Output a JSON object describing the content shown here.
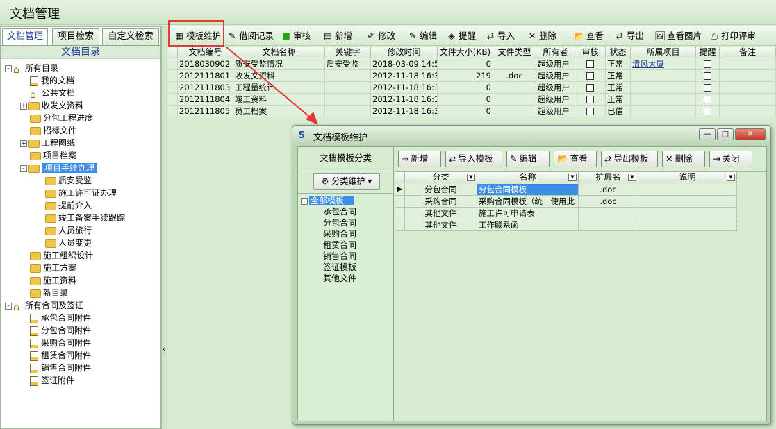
{
  "app": {
    "title": "文档管理"
  },
  "left": {
    "tabs": [
      "文档管理",
      "项目检索",
      "自定义检索"
    ],
    "dir_title": "文档目录",
    "tree": [
      {
        "label": "所有目录",
        "type": "home",
        "exp": "-"
      },
      {
        "label": "我的文档",
        "type": "doc"
      },
      {
        "label": "公共文档",
        "type": "home"
      },
      {
        "label": "收发文资料",
        "type": "folder",
        "exp": "+"
      },
      {
        "label": "分包工程进度",
        "type": "folder"
      },
      {
        "label": "招标文件",
        "type": "folder"
      },
      {
        "label": "工程图纸",
        "type": "folder",
        "exp": "+"
      },
      {
        "label": "项目档案",
        "type": "folder"
      },
      {
        "label": "项目手续办理",
        "type": "folder",
        "exp": "-",
        "selected": true
      },
      {
        "label": "质安受监",
        "type": "folder"
      },
      {
        "label": "施工许可证办理",
        "type": "folder"
      },
      {
        "label": "提前介入",
        "type": "folder"
      },
      {
        "label": "竣工备案手续跟踪",
        "type": "folder"
      },
      {
        "label": "人员旅行",
        "type": "folder"
      },
      {
        "label": "人员变更",
        "type": "folder"
      },
      {
        "label": "施工组织设计",
        "type": "folder"
      },
      {
        "label": "施工方案",
        "type": "folder"
      },
      {
        "label": "施工资料",
        "type": "folder"
      },
      {
        "label": "新目录",
        "type": "folder"
      },
      {
        "label": "所有合同及签证",
        "type": "home",
        "exp": "-"
      },
      {
        "label": "承包合同附件",
        "type": "doc"
      },
      {
        "label": "分包合同附件",
        "type": "doc"
      },
      {
        "label": "采购合同附件",
        "type": "doc"
      },
      {
        "label": "租赁合同附件",
        "type": "doc"
      },
      {
        "label": "销售合同附件",
        "type": "doc"
      },
      {
        "label": "签证附件",
        "type": "doc"
      }
    ]
  },
  "toolbar": {
    "buttons": [
      {
        "label": "模板维护",
        "icon": "template-icon"
      },
      {
        "label": "借阅记录",
        "icon": "borrow-icon"
      },
      {
        "label": "审核",
        "icon": "approve-icon"
      },
      {
        "label": "新增",
        "icon": "new-icon"
      },
      {
        "label": "修改",
        "icon": "edit-icon"
      },
      {
        "label": "编辑",
        "icon": "pencil-icon"
      },
      {
        "label": "提醒",
        "icon": "reminder-icon"
      },
      {
        "label": "导入",
        "icon": "import-icon"
      },
      {
        "label": "删除",
        "icon": "delete-icon"
      },
      {
        "label": "查看",
        "icon": "view-icon"
      },
      {
        "label": "导出",
        "icon": "export-icon"
      },
      {
        "label": "查看图片",
        "icon": "image-view-icon"
      },
      {
        "label": "打印评审",
        "icon": "print-icon"
      }
    ]
  },
  "grid": {
    "columns": [
      "文档编号",
      "文档名称",
      "关键字",
      "修改时间",
      "文件大小(KB)",
      "文件类型",
      "所有者",
      "审核",
      "状态",
      "所属项目",
      "提醒",
      "备注"
    ],
    "rows": [
      {
        "id": "2018030902",
        "name": "质安受监情况",
        "keyword": "质安受监",
        "time": "2018-03-09 14:5",
        "size": "0",
        "type": "",
        "owner": "超级用户",
        "status": "正常",
        "project": "清风大厦"
      },
      {
        "id": "2012111801",
        "name": "收发文资料",
        "keyword": "",
        "time": "2012-11-18 16:3",
        "size": "219",
        "type": ".doc",
        "owner": "超级用户",
        "status": "正常",
        "project": ""
      },
      {
        "id": "2012111803",
        "name": "工程量统计",
        "keyword": "",
        "time": "2012-11-18 16:3",
        "size": "0",
        "type": "",
        "owner": "超级用户",
        "status": "正常",
        "project": ""
      },
      {
        "id": "2012111804",
        "name": "竣工资料",
        "keyword": "",
        "time": "2012-11-18 16:3",
        "size": "0",
        "type": "",
        "owner": "超级用户",
        "status": "正常",
        "project": ""
      },
      {
        "id": "2012111805",
        "name": "员工档案",
        "keyword": "",
        "time": "2012-11-18 16:3",
        "size": "0",
        "type": "",
        "owner": "超级用户",
        "status": "已借",
        "project": ""
      }
    ]
  },
  "dialog": {
    "title": "文档模板维护",
    "category_header": "文档模板分类",
    "category_button": "分类维护",
    "category_tree": [
      "全部模板",
      "承包合同",
      "分包合同",
      "采购合同",
      "租赁合同",
      "销售合同",
      "签证模板",
      "其他文件"
    ],
    "buttons": [
      {
        "label": "新增",
        "icon": "new-icon"
      },
      {
        "label": "导入模板",
        "icon": "import-icon"
      },
      {
        "label": "编辑",
        "icon": "pencil-icon"
      },
      {
        "label": "查看",
        "icon": "view-icon"
      },
      {
        "label": "导出模板",
        "icon": "export-icon"
      },
      {
        "label": "删除",
        "icon": "delete-icon"
      },
      {
        "label": "关闭",
        "icon": "exit-icon"
      }
    ],
    "columns": [
      "分类",
      "名称",
      "扩展名",
      "说明"
    ],
    "rows": [
      {
        "category": "分包合同",
        "name": "分包合同模板",
        "ext": ".doc",
        "desc": ""
      },
      {
        "category": "采购合同",
        "name": "采购合同模板（统一使用此",
        "ext": ".doc",
        "desc": ""
      },
      {
        "category": "其他文件",
        "name": "施工许可申请表",
        "ext": "",
        "desc": ""
      },
      {
        "category": "其他文件",
        "name": "工作联系函",
        "ext": "",
        "desc": ""
      }
    ]
  },
  "colors": {
    "background": "#d6ebd0",
    "selection": "#3d8ee6",
    "highlight": "#e53935"
  }
}
